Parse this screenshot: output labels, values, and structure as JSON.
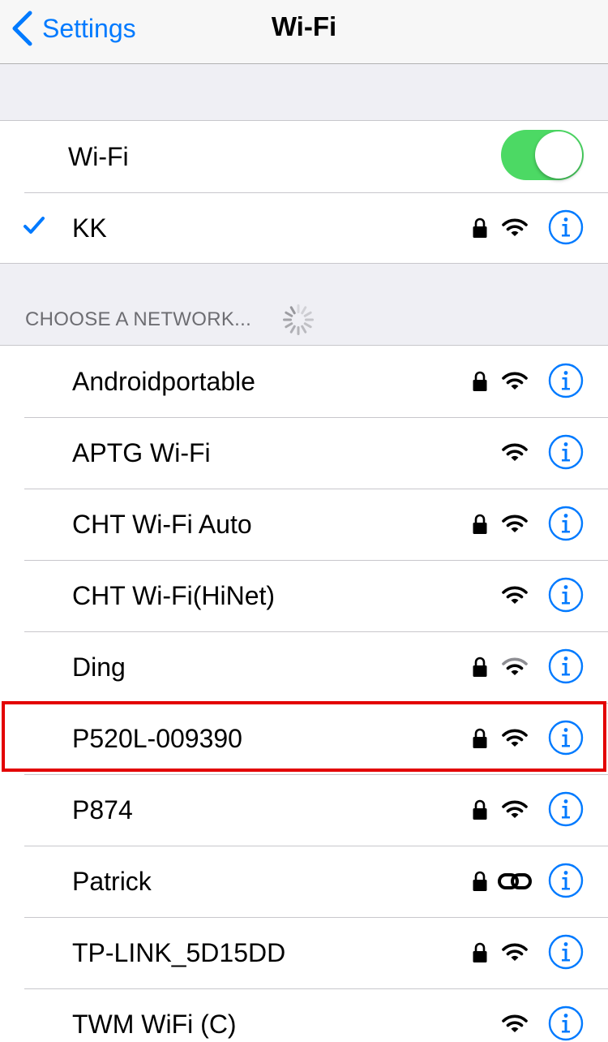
{
  "nav": {
    "back_label": "Settings",
    "title": "Wi-Fi"
  },
  "wifi_toggle": {
    "label": "Wi-Fi",
    "on": true
  },
  "connected": {
    "name": "KK",
    "secured": true,
    "signal": "full",
    "checkmark": true
  },
  "section_header": "CHOOSE A NETWORK...",
  "networks": [
    {
      "name": "Androidportable",
      "secured": true,
      "icon": "wifi-icon",
      "signal": "full"
    },
    {
      "name": "APTG Wi-Fi",
      "secured": false,
      "icon": "wifi-icon",
      "signal": "full"
    },
    {
      "name": "CHT Wi-Fi Auto",
      "secured": true,
      "icon": "wifi-icon",
      "signal": "full"
    },
    {
      "name": "CHT Wi-Fi(HiNet)",
      "secured": false,
      "icon": "wifi-icon",
      "signal": "full"
    },
    {
      "name": "Ding",
      "secured": true,
      "icon": "wifi-icon",
      "signal": "weak"
    },
    {
      "name": "P520L-009390",
      "secured": true,
      "icon": "wifi-icon",
      "signal": "full",
      "highlighted": true
    },
    {
      "name": "P874",
      "secured": true,
      "icon": "wifi-icon",
      "signal": "full"
    },
    {
      "name": "Patrick",
      "secured": true,
      "icon": "link-icon",
      "signal": "full"
    },
    {
      "name": "TP-LINK_5D15DD",
      "secured": true,
      "icon": "wifi-icon",
      "signal": "full"
    },
    {
      "name": "TWM WiFi (C)",
      "secured": false,
      "icon": "wifi-icon",
      "signal": "full"
    }
  ],
  "colors": {
    "accent": "#007aff",
    "toggle_on": "#4cd964",
    "highlight": "#e30000",
    "background": "#efeff4"
  }
}
